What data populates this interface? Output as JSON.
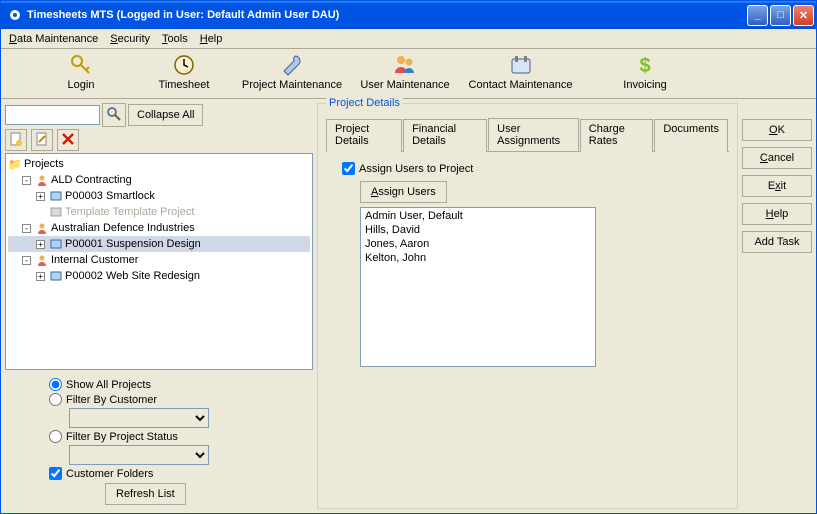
{
  "title": "Timesheets MTS (Logged in User: Default Admin User DAU)",
  "menus": {
    "data": "Data Maintenance",
    "security": "Security",
    "tools": "Tools",
    "help": "Help"
  },
  "toolbar": {
    "login": "Login",
    "timesheet": "Timesheet",
    "project_maint": "Project Maintenance",
    "user_maint": "User Maintenance",
    "contact_maint": "Contact Maintenance",
    "invoicing": "Invoicing"
  },
  "left": {
    "collapse": "Collapse All",
    "root": "Projects",
    "customers": [
      {
        "name": "ALD Contracting",
        "projects": [
          {
            "code": "P00003 Smartlock",
            "selected": false
          },
          {
            "code": "Template Template Project",
            "disabled": true
          }
        ]
      },
      {
        "name": "Australian Defence Industries",
        "projects": [
          {
            "code": "P00001 Suspension Design",
            "selected": true
          }
        ]
      },
      {
        "name": "Internal Customer",
        "projects": [
          {
            "code": "P00002 Web Site Redesign"
          }
        ]
      }
    ],
    "filters": {
      "show_all": "Show All Projects",
      "by_customer": "Filter By Customer",
      "by_status": "Filter By Project Status",
      "customer_folders": "Customer Folders",
      "refresh": "Refresh List"
    }
  },
  "details": {
    "title": "Project Details",
    "tabs": {
      "project": "Project Details",
      "financial": "Financial Details",
      "user_assign": "User Assignments",
      "charge": "Charge Rates",
      "documents": "Documents"
    },
    "assign_chk": "Assign Users to Project",
    "assign_btn": "Assign Users",
    "users": [
      "Admin User, Default",
      "Hills, David",
      "Jones, Aaron",
      "Kelton, John"
    ]
  },
  "actions": {
    "ok": "OK",
    "cancel": "Cancel",
    "exit": "Exit",
    "help": "Help",
    "add_task": "Add Task"
  }
}
